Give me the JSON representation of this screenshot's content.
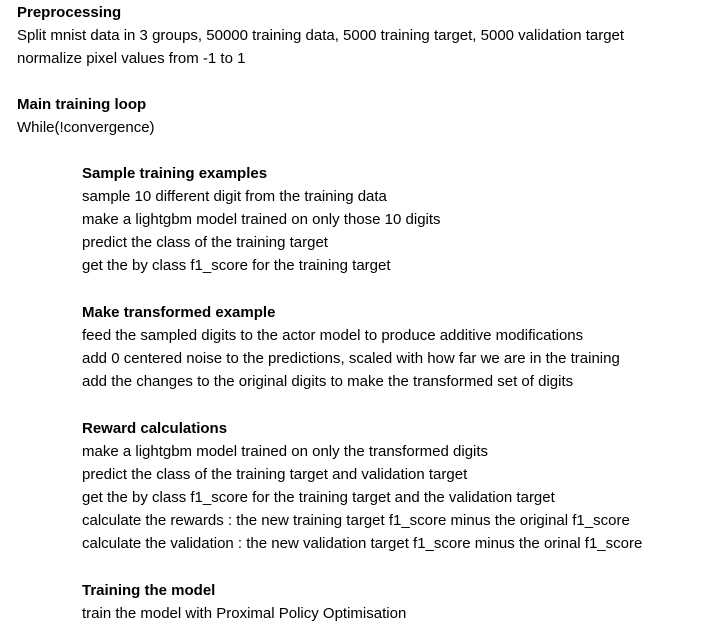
{
  "preprocessing": {
    "heading": "Preprocessing",
    "lines": [
      "Split mnist data in 3 groups, 50000 training data, 5000 training target, 5000 validation target",
      "normalize pixel values from -1 to 1"
    ]
  },
  "main_loop": {
    "heading": "Main training loop",
    "lines": [
      "While(!convergence)"
    ]
  },
  "sample_training": {
    "heading": "Sample training examples",
    "lines": [
      "sample 10 different digit from the training data",
      "make a lightgbm model trained on only those 10 digits",
      "predict the class of the training target",
      "get the by class f1_score for the training target"
    ]
  },
  "transformed_example": {
    "heading": "Make transformed example",
    "lines": [
      "feed the sampled digits to the actor model to produce additive modifications",
      "add 0 centered noise to the predictions, scaled with how far we are in the training",
      "add the changes to the original digits to make the transformed set of digits"
    ]
  },
  "reward_calculations": {
    "heading": "Reward calculations",
    "lines": [
      "make a lightgbm model trained on only the transformed digits",
      "predict the class of the training target and validation target",
      "get the by class f1_score for the training target and the validation target",
      "calculate the rewards : the new training target f1_score minus the original f1_score",
      "calculate the validation : the new validation target f1_score minus the orinal f1_score"
    ]
  },
  "training_model": {
    "heading": "Training the model",
    "lines": [
      "train the model with Proximal Policy Optimisation"
    ]
  }
}
